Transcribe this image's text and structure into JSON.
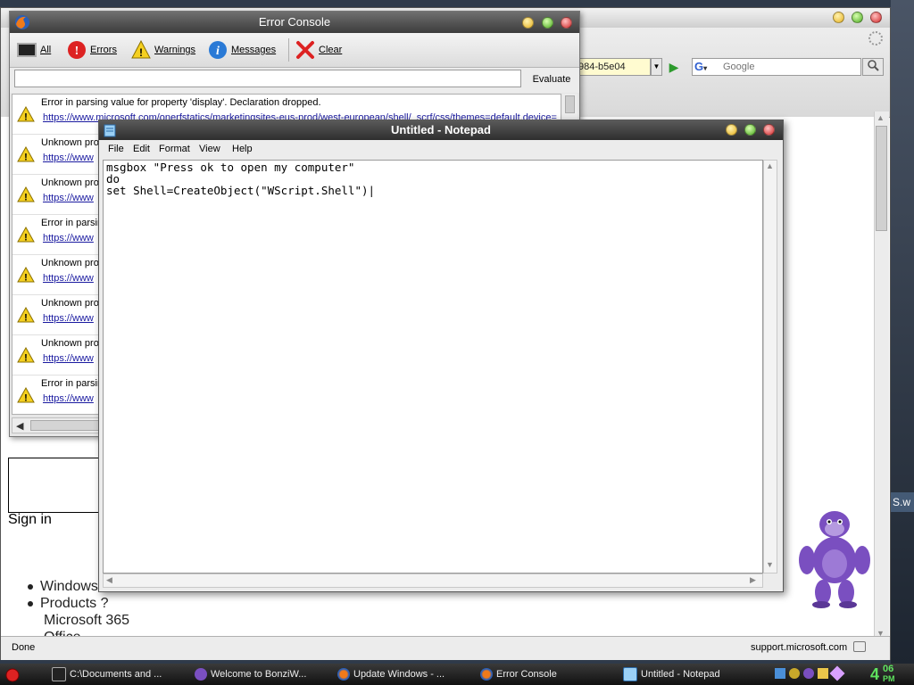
{
  "browser": {
    "url_fragment": "984-b5e04",
    "search_engine_logo": "G",
    "search_placeholder": "Google",
    "status": "Done",
    "status_site": "support.microsoft.com",
    "page": {
      "sign_in": "Sign in",
      "nav": [
        "Windows",
        "Products  ?",
        "Microsoft 365",
        "Office"
      ]
    },
    "right_edge_text": "S.w"
  },
  "error_console": {
    "title": "Error Console",
    "toolbar": {
      "all": "All",
      "errors": "Errors",
      "warnings": "Warnings",
      "messages": "Messages",
      "clear": "Clear"
    },
    "evaluate_label": "Evaluate",
    "evaluate_value": "",
    "rows": [
      {
        "message": "Error in parsing value for property 'display'. Declaration dropped.",
        "link": "https://www.microsoft.com/onerfstatics/marketingsites-eus-prod/west-european/shell/_scrf/css/themes=default.device="
      },
      {
        "message": "Unknown pro",
        "link": "https://www"
      },
      {
        "message": "Unknown pro",
        "link": "https://www"
      },
      {
        "message": "Error in parsin",
        "link": "https://www"
      },
      {
        "message": "Unknown pro",
        "link": "https://www"
      },
      {
        "message": "Unknown pro",
        "link": "https://www"
      },
      {
        "message": "Unknown pro",
        "link": "https://www"
      },
      {
        "message": "Error in parsin",
        "link": "https://www"
      }
    ]
  },
  "notepad": {
    "title": "Untitled - Notepad",
    "menu": [
      "File",
      "Edit",
      "Format",
      "View",
      "Help"
    ],
    "content": "msgbox \"Press ok to open my computer\"\ndo\nset Shell=CreateObject(\"WScript.Shell\")|"
  },
  "taskbar": {
    "tasks": [
      {
        "label": "C:\\Documents and ...",
        "icon": "cmd-icon"
      },
      {
        "label": "Welcome to BonziW...",
        "icon": "bonzi-icon"
      },
      {
        "label": "Update Windows - ...",
        "icon": "firefox-icon"
      },
      {
        "label": "Error Console",
        "icon": "firefox-icon"
      },
      {
        "label": "Untitled - Notepad",
        "icon": "notepad-icon"
      }
    ],
    "clock_hour": "4",
    "clock_minutes": "06",
    "clock_ampm": "PM"
  },
  "colors": {
    "link": "#1a1aa0",
    "clock": "#5fe35f",
    "bonzi": "#7a4fc0"
  }
}
